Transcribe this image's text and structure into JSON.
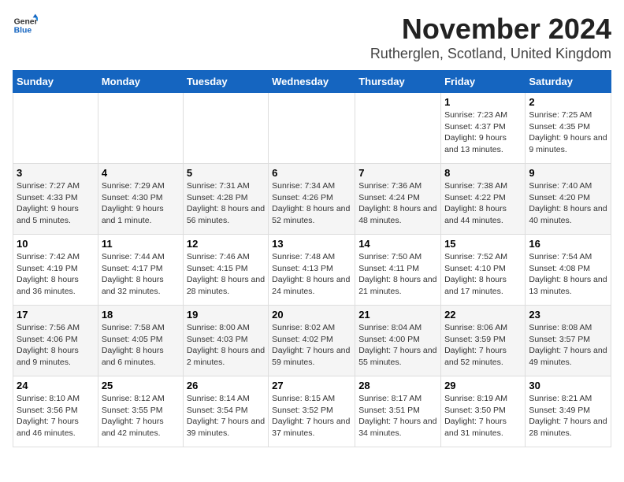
{
  "header": {
    "logo_general": "General",
    "logo_blue": "Blue",
    "month_title": "November 2024",
    "location": "Rutherglen, Scotland, United Kingdom"
  },
  "days_of_week": [
    "Sunday",
    "Monday",
    "Tuesday",
    "Wednesday",
    "Thursday",
    "Friday",
    "Saturday"
  ],
  "weeks": [
    [
      {
        "day": "",
        "info": ""
      },
      {
        "day": "",
        "info": ""
      },
      {
        "day": "",
        "info": ""
      },
      {
        "day": "",
        "info": ""
      },
      {
        "day": "",
        "info": ""
      },
      {
        "day": "1",
        "info": "Sunrise: 7:23 AM\nSunset: 4:37 PM\nDaylight: 9 hours and 13 minutes."
      },
      {
        "day": "2",
        "info": "Sunrise: 7:25 AM\nSunset: 4:35 PM\nDaylight: 9 hours and 9 minutes."
      }
    ],
    [
      {
        "day": "3",
        "info": "Sunrise: 7:27 AM\nSunset: 4:33 PM\nDaylight: 9 hours and 5 minutes."
      },
      {
        "day": "4",
        "info": "Sunrise: 7:29 AM\nSunset: 4:30 PM\nDaylight: 9 hours and 1 minute."
      },
      {
        "day": "5",
        "info": "Sunrise: 7:31 AM\nSunset: 4:28 PM\nDaylight: 8 hours and 56 minutes."
      },
      {
        "day": "6",
        "info": "Sunrise: 7:34 AM\nSunset: 4:26 PM\nDaylight: 8 hours and 52 minutes."
      },
      {
        "day": "7",
        "info": "Sunrise: 7:36 AM\nSunset: 4:24 PM\nDaylight: 8 hours and 48 minutes."
      },
      {
        "day": "8",
        "info": "Sunrise: 7:38 AM\nSunset: 4:22 PM\nDaylight: 8 hours and 44 minutes."
      },
      {
        "day": "9",
        "info": "Sunrise: 7:40 AM\nSunset: 4:20 PM\nDaylight: 8 hours and 40 minutes."
      }
    ],
    [
      {
        "day": "10",
        "info": "Sunrise: 7:42 AM\nSunset: 4:19 PM\nDaylight: 8 hours and 36 minutes."
      },
      {
        "day": "11",
        "info": "Sunrise: 7:44 AM\nSunset: 4:17 PM\nDaylight: 8 hours and 32 minutes."
      },
      {
        "day": "12",
        "info": "Sunrise: 7:46 AM\nSunset: 4:15 PM\nDaylight: 8 hours and 28 minutes."
      },
      {
        "day": "13",
        "info": "Sunrise: 7:48 AM\nSunset: 4:13 PM\nDaylight: 8 hours and 24 minutes."
      },
      {
        "day": "14",
        "info": "Sunrise: 7:50 AM\nSunset: 4:11 PM\nDaylight: 8 hours and 21 minutes."
      },
      {
        "day": "15",
        "info": "Sunrise: 7:52 AM\nSunset: 4:10 PM\nDaylight: 8 hours and 17 minutes."
      },
      {
        "day": "16",
        "info": "Sunrise: 7:54 AM\nSunset: 4:08 PM\nDaylight: 8 hours and 13 minutes."
      }
    ],
    [
      {
        "day": "17",
        "info": "Sunrise: 7:56 AM\nSunset: 4:06 PM\nDaylight: 8 hours and 9 minutes."
      },
      {
        "day": "18",
        "info": "Sunrise: 7:58 AM\nSunset: 4:05 PM\nDaylight: 8 hours and 6 minutes."
      },
      {
        "day": "19",
        "info": "Sunrise: 8:00 AM\nSunset: 4:03 PM\nDaylight: 8 hours and 2 minutes."
      },
      {
        "day": "20",
        "info": "Sunrise: 8:02 AM\nSunset: 4:02 PM\nDaylight: 7 hours and 59 minutes."
      },
      {
        "day": "21",
        "info": "Sunrise: 8:04 AM\nSunset: 4:00 PM\nDaylight: 7 hours and 55 minutes."
      },
      {
        "day": "22",
        "info": "Sunrise: 8:06 AM\nSunset: 3:59 PM\nDaylight: 7 hours and 52 minutes."
      },
      {
        "day": "23",
        "info": "Sunrise: 8:08 AM\nSunset: 3:57 PM\nDaylight: 7 hours and 49 minutes."
      }
    ],
    [
      {
        "day": "24",
        "info": "Sunrise: 8:10 AM\nSunset: 3:56 PM\nDaylight: 7 hours and 46 minutes."
      },
      {
        "day": "25",
        "info": "Sunrise: 8:12 AM\nSunset: 3:55 PM\nDaylight: 7 hours and 42 minutes."
      },
      {
        "day": "26",
        "info": "Sunrise: 8:14 AM\nSunset: 3:54 PM\nDaylight: 7 hours and 39 minutes."
      },
      {
        "day": "27",
        "info": "Sunrise: 8:15 AM\nSunset: 3:52 PM\nDaylight: 7 hours and 37 minutes."
      },
      {
        "day": "28",
        "info": "Sunrise: 8:17 AM\nSunset: 3:51 PM\nDaylight: 7 hours and 34 minutes."
      },
      {
        "day": "29",
        "info": "Sunrise: 8:19 AM\nSunset: 3:50 PM\nDaylight: 7 hours and 31 minutes."
      },
      {
        "day": "30",
        "info": "Sunrise: 8:21 AM\nSunset: 3:49 PM\nDaylight: 7 hours and 28 minutes."
      }
    ]
  ]
}
